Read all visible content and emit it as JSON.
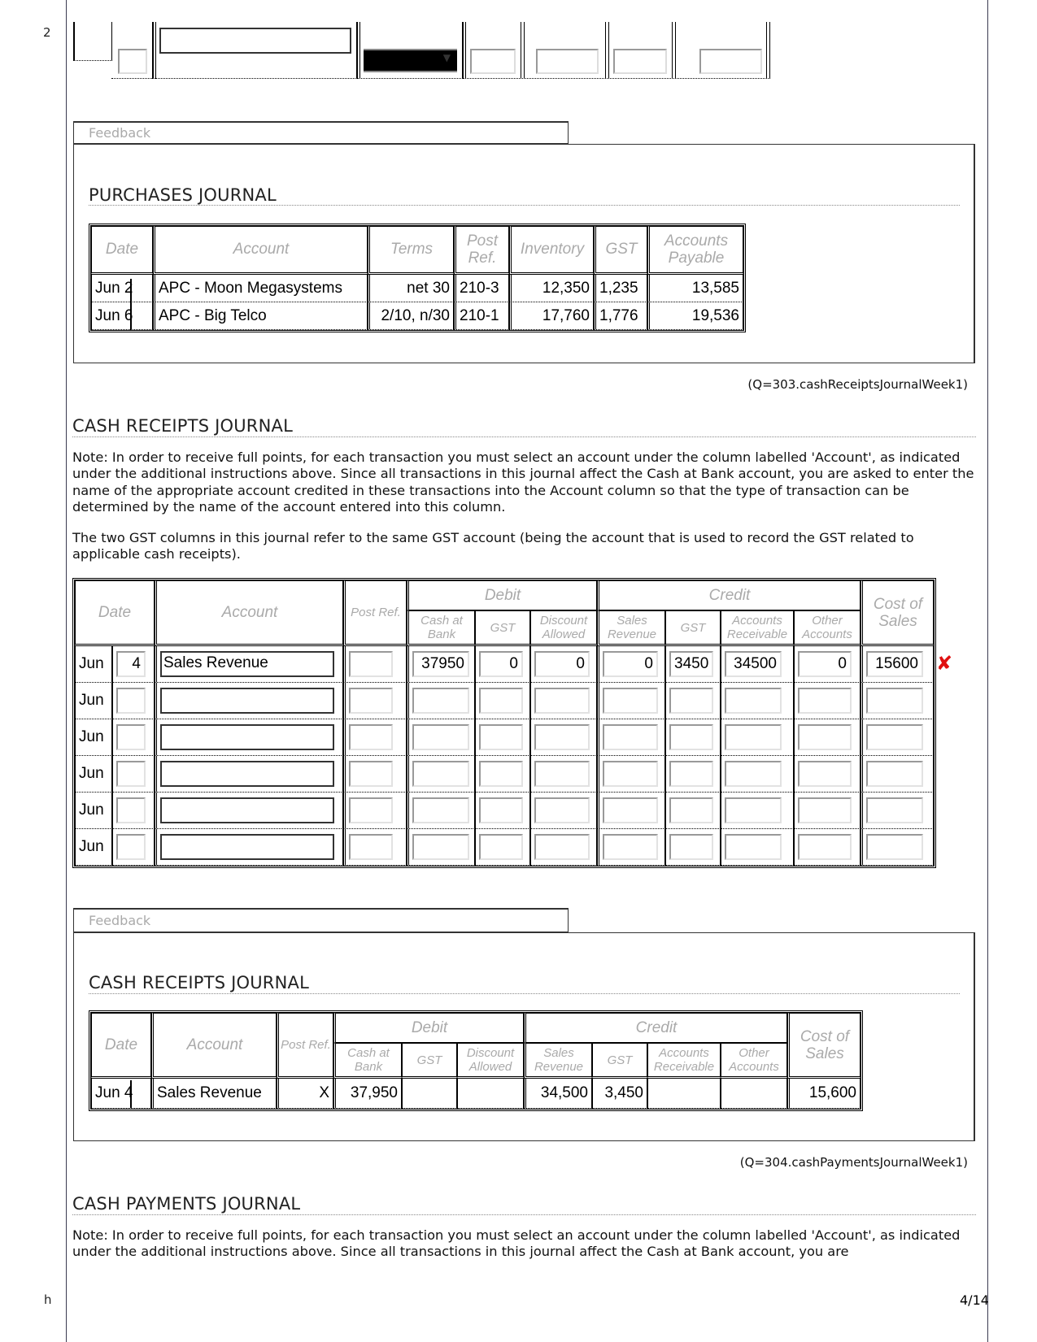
{
  "page": {
    "margin_top_number": "2",
    "margin_bottom_letter": "h",
    "page_indicator": "4/14"
  },
  "feedback_label": "Feedback",
  "purchases_journal": {
    "title": "PURCHASES JOURNAL",
    "columns": [
      "Date",
      "Account",
      "Terms",
      "Post Ref.",
      "Inventory",
      "GST",
      "Accounts Payable"
    ],
    "rows": [
      {
        "date": "Jun 2",
        "account": "APC - Moon Megasystems",
        "terms": "net 30",
        "post_ref": "210-3",
        "inventory": "12,350",
        "gst": "1,235",
        "accounts_payable": "13,585"
      },
      {
        "date": "Jun 6",
        "account": "APC - Big Telco",
        "terms": "2/10, n/30",
        "post_ref": "210-1",
        "inventory": "17,760",
        "gst": "1,776",
        "accounts_payable": "19,536"
      }
    ]
  },
  "cash_receipts_question": {
    "qref": "(Q=303.cashReceiptsJournalWeek1)",
    "title": "CASH RECEIPTS JOURNAL",
    "note1": "Note: In order to receive full points, for each transaction you must select an account under the column labelled 'Account', as indicated under the additional instructions above. Since all transactions in this journal affect the Cash at Bank account, you are asked to enter the name of the appropriate account credited in these transactions into the Account column so that the type of transaction can be determined by the name of the account entered into this column.",
    "note2": "The two GST columns in this journal refer to the same GST account (being the account that is used to record the GST related to applicable cash receipts).",
    "headers": {
      "date": "Date",
      "account": "Account",
      "post_ref": "Post Ref.",
      "debit": "Debit",
      "credit": "Credit",
      "cash_at_bank": "Cash at Bank",
      "debit_gst": "GST",
      "discount_allowed": "Discount Allowed",
      "sales_revenue": "Sales Revenue",
      "credit_gst": "GST",
      "accounts_receivable": "Accounts Receivable",
      "other_accounts": "Other Accounts",
      "cost_of_sales": "Cost of Sales"
    },
    "rows": [
      {
        "month": "Jun",
        "day": "4",
        "account": "Sales Revenue",
        "post_ref": "",
        "cash_at_bank": "37950",
        "debit_gst": "0",
        "discount_allowed": "0",
        "sales_revenue": "0",
        "credit_gst": "3450",
        "accounts_receivable": "34500",
        "other_accounts": "0",
        "cost_of_sales": "15600",
        "status": "incorrect"
      },
      {
        "month": "Jun",
        "day": "",
        "account": "",
        "post_ref": "",
        "cash_at_bank": "",
        "debit_gst": "",
        "discount_allowed": "",
        "sales_revenue": "",
        "credit_gst": "",
        "accounts_receivable": "",
        "other_accounts": "",
        "cost_of_sales": ""
      },
      {
        "month": "Jun",
        "day": "",
        "account": "",
        "post_ref": "",
        "cash_at_bank": "",
        "debit_gst": "",
        "discount_allowed": "",
        "sales_revenue": "",
        "credit_gst": "",
        "accounts_receivable": "",
        "other_accounts": "",
        "cost_of_sales": ""
      },
      {
        "month": "Jun",
        "day": "",
        "account": "",
        "post_ref": "",
        "cash_at_bank": "",
        "debit_gst": "",
        "discount_allowed": "",
        "sales_revenue": "",
        "credit_gst": "",
        "accounts_receivable": "",
        "other_accounts": "",
        "cost_of_sales": ""
      },
      {
        "month": "Jun",
        "day": "",
        "account": "",
        "post_ref": "",
        "cash_at_bank": "",
        "debit_gst": "",
        "discount_allowed": "",
        "sales_revenue": "",
        "credit_gst": "",
        "accounts_receivable": "",
        "other_accounts": "",
        "cost_of_sales": ""
      },
      {
        "month": "Jun",
        "day": "",
        "account": "",
        "post_ref": "",
        "cash_at_bank": "",
        "debit_gst": "",
        "discount_allowed": "",
        "sales_revenue": "",
        "credit_gst": "",
        "accounts_receivable": "",
        "other_accounts": "",
        "cost_of_sales": ""
      }
    ],
    "incorrect_icon": "✘"
  },
  "cash_receipts_feedback": {
    "title": "CASH RECEIPTS JOURNAL",
    "rows": [
      {
        "date": "Jun 4",
        "account": "Sales Revenue",
        "post_ref": "X",
        "cash_at_bank": "37,950",
        "debit_gst": "",
        "discount_allowed": "",
        "sales_revenue": "34,500",
        "credit_gst": "3,450",
        "accounts_receivable": "",
        "other_accounts": "",
        "cost_of_sales": "15,600"
      }
    ]
  },
  "cash_payments_question": {
    "qref": "(Q=304.cashPaymentsJournalWeek1)",
    "title": "CASH PAYMENTS JOURNAL",
    "note1": "Note: In order to receive full points, for each transaction you must select an account under the column labelled 'Account', as indicated under the additional instructions above. Since all transactions in this journal affect the Cash at Bank account, you are"
  }
}
